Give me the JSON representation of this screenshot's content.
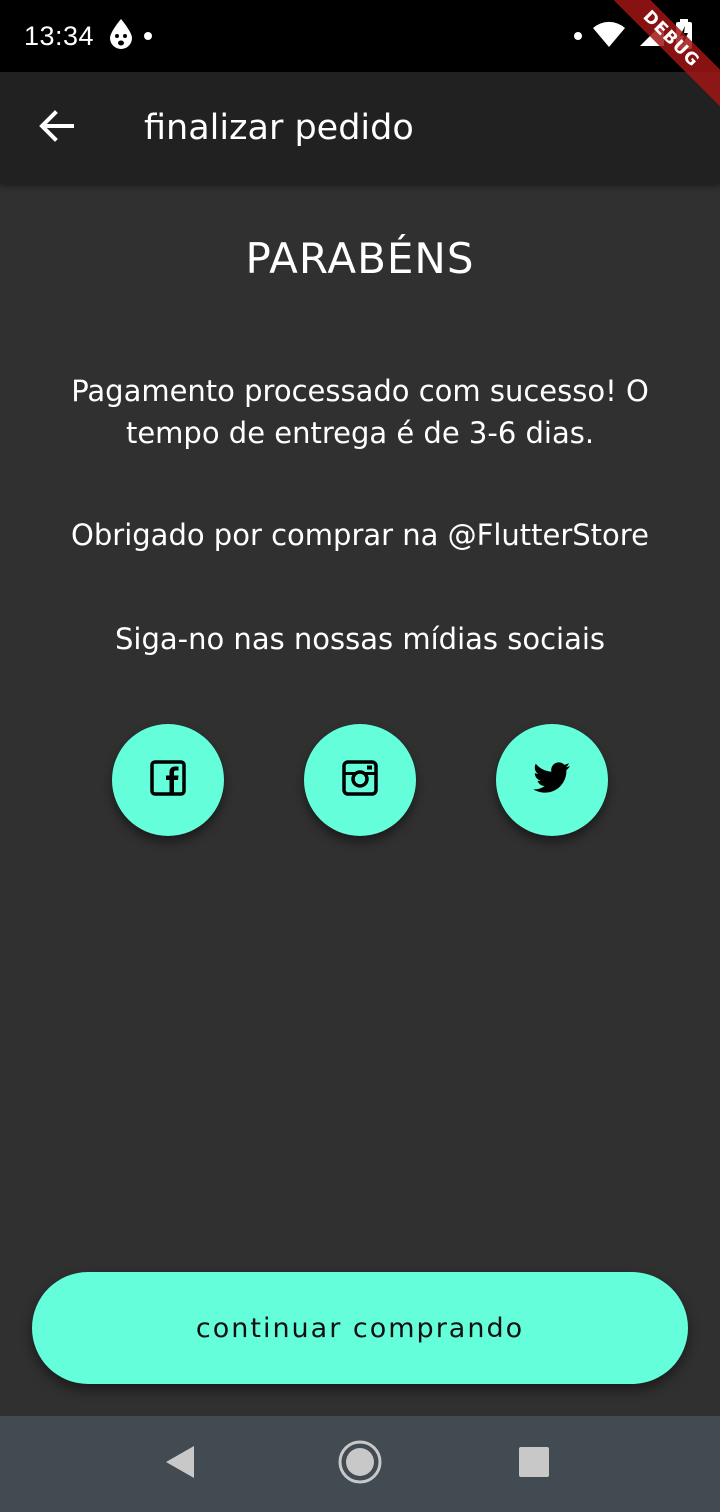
{
  "status_bar": {
    "time": "13:34",
    "debug_label": "DEBUG",
    "icons": [
      "notification-drop-icon",
      "dot-icon",
      "wifi-icon",
      "signal-icon",
      "battery-icon"
    ]
  },
  "app_bar": {
    "title": "finalizar pedido",
    "back_icon": "arrow-back-icon"
  },
  "content": {
    "heading": "PARABÉNS",
    "success_message": "Pagamento processado com sucesso! O tempo de entrega é de 3-6 dias.",
    "thanks_message": "Obrigado por comprar na @FlutterStore",
    "follow_message": "Siga-no nas nossas mídias sociais",
    "social": [
      {
        "icon": "facebook-icon"
      },
      {
        "icon": "instagram-icon"
      },
      {
        "icon": "twitter-icon"
      }
    ]
  },
  "continue_button": {
    "label": "continuar comprando"
  },
  "nav_bar": {
    "icons": [
      "nav-back-icon",
      "nav-home-icon",
      "nav-recents-icon"
    ]
  },
  "colors": {
    "background": "#303030",
    "app_bar": "#212121",
    "accent": "#64ffda",
    "nav_bar": "#424a52"
  }
}
